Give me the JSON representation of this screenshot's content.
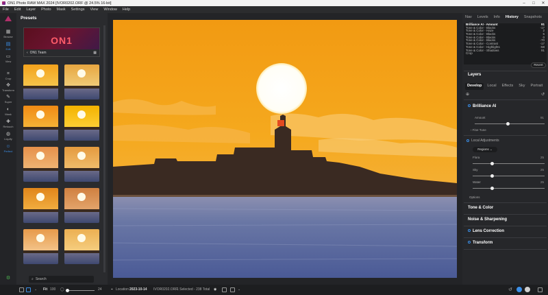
{
  "window": {
    "title": "ON1 Photo RAW MAX 2024 [IVOR0202.ORF @ 24.5% 16-bit]"
  },
  "menu": [
    "File",
    "Edit",
    "Layer",
    "Photo",
    "Mask",
    "Settings",
    "View",
    "Window",
    "Help"
  ],
  "tools": {
    "browse": "Browse",
    "edit": "Edit",
    "view": "View",
    "crop": "Crop",
    "transform": "Transform",
    "super": "Super",
    "mask": "Mask",
    "retouch": "Retouch",
    "liquify": "Liquify",
    "perfect": "Perfect"
  },
  "presets": {
    "title": "Presets",
    "banner_logo": "ON1",
    "banner_label": "ON1 Team",
    "search_placeholder": "Search",
    "thumb_colors": [
      [
        "#f3a21c",
        "#f7c850"
      ],
      [
        "#e7a640",
        "#f1cf7e"
      ],
      [
        "#f08a14",
        "#f6b73a"
      ],
      [
        "#f3b200",
        "#ffd23a"
      ],
      [
        "#e6904a",
        "#f0b878"
      ],
      [
        "#e49a3e",
        "#f2c070"
      ],
      [
        "#e0851a",
        "#f3b244"
      ],
      [
        "#d08040",
        "#e5a870"
      ],
      [
        "#e79a4a",
        "#f4c890"
      ],
      [
        "#ecb052",
        "#f6d184"
      ]
    ]
  },
  "right_panel": {
    "tabs": [
      "Nav",
      "Levels",
      "Info",
      "History",
      "Snapshots"
    ],
    "active_tab": "History",
    "history": [
      {
        "label": "Brilliance AI - Amount",
        "value": "91"
      },
      {
        "label": "Tone & Color - Blacks",
        "value": "-17"
      },
      {
        "label": "Tone & Color - Haze",
        "value": "2"
      },
      {
        "label": "Tone & Color - Blacks",
        "value": "5"
      },
      {
        "label": "Tone & Color - Blacks",
        "value": "0"
      },
      {
        "label": "Tone & Color - Blacks",
        "value": "-70"
      },
      {
        "label": "Tone & Color - Contrast",
        "value": "-17"
      },
      {
        "label": "Tone & Color - Highlights",
        "value": "-58"
      },
      {
        "label": "Tone & Color - Shadows",
        "value": "91"
      },
      {
        "label": "Crop",
        "value": ""
      }
    ],
    "revert_label": "Revert",
    "layers_label": "Layers",
    "develop_tabs": [
      "Develop",
      "Local",
      "Effects",
      "Sky",
      "Portrait"
    ],
    "brilliance_label": "Brilliance AI",
    "amount_label": "Amount",
    "amount_value": "91",
    "fine_tune_label": "Fine Tune",
    "local_adjustments_label": "Local Adjustments",
    "regions_label": "Regions",
    "flora_label": "Flora",
    "flora_value": "25",
    "sky_label": "Sky",
    "sky_value": "25",
    "water_label": "Water",
    "water_value": "25",
    "options_label": "Options",
    "sections": [
      "Tone & Color",
      "Noise & Sharpening",
      "Lens Correction",
      "Transform"
    ]
  },
  "bottom": {
    "fit_label": "Fit",
    "zoom_value": "100",
    "zoom_max": "24",
    "location_label": "Location",
    "location_value": "2023-10-14",
    "filename": "IVOR0202.ORF",
    "selection": "1 Selected - 238 Total"
  }
}
